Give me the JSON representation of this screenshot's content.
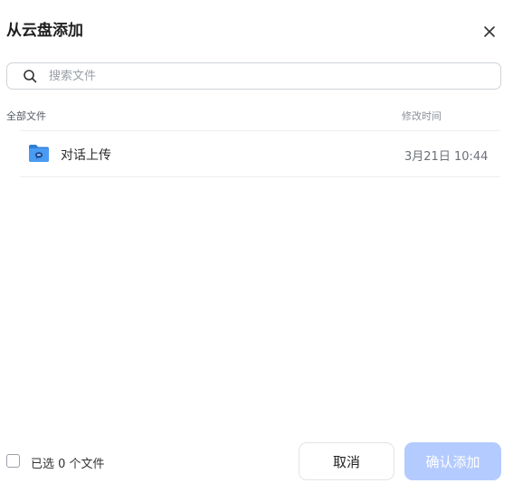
{
  "dialog": {
    "title": "从云盘添加",
    "close_icon": "close-icon"
  },
  "search": {
    "placeholder": "搜索文件",
    "value": "",
    "icon": "search-icon"
  },
  "list": {
    "header": {
      "name_label": "全部文件",
      "time_label": "修改时间"
    },
    "items": [
      {
        "name": "对话上传",
        "modified": "3月21日 10:44",
        "icon": "folder-chat-icon"
      }
    ]
  },
  "footer": {
    "selected_status": "已选 0 个文件",
    "cancel_label": "取消",
    "confirm_label": "确认添加"
  },
  "colors": {
    "accent": "#4d8dff",
    "accent_disabled": "#b4cbff",
    "folder": "#4a9bf2",
    "folder_dark": "#2f7fd8"
  }
}
